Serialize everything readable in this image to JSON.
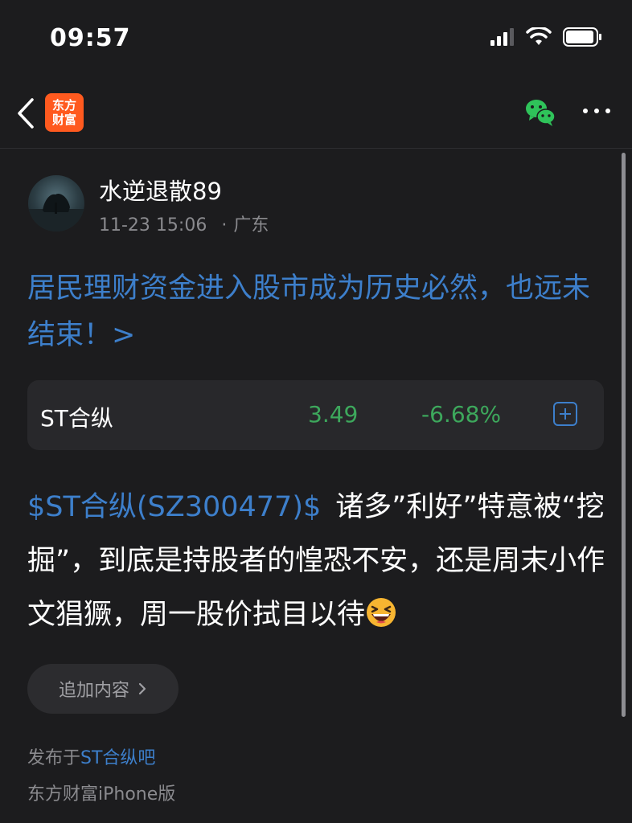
{
  "status_bar": {
    "time": "09:57"
  },
  "nav": {
    "logo_line1": "东方",
    "logo_line2": "财富"
  },
  "post": {
    "author": "水逆退散89",
    "timestamp": "11-23 15:06",
    "location": "广东",
    "title": "居民理财资金进入股市成为历史必然，也远未结束！>",
    "stock": {
      "name": "ST合纵",
      "price": "3.49",
      "change": "-6.68%",
      "change_color": "#3da85c"
    },
    "body_tag": "$ST合纵(SZ300477)$",
    "body_text": "诸多”利好”特意被“挖掘”，到底是持股者的惶恐不安，还是周末小作文猖獗，周一股价拭目以待",
    "emoji": "grinning-squinting-face",
    "append_button": "追加内容",
    "posted_in_prefix": "发布于",
    "posted_in_link": "ST合纵吧",
    "client": "东方财富iPhone版"
  },
  "colors": {
    "accent": "#3d7fcb",
    "brand": "#ff5a1f",
    "down": "#3da85c",
    "background": "#1c1c1e"
  }
}
